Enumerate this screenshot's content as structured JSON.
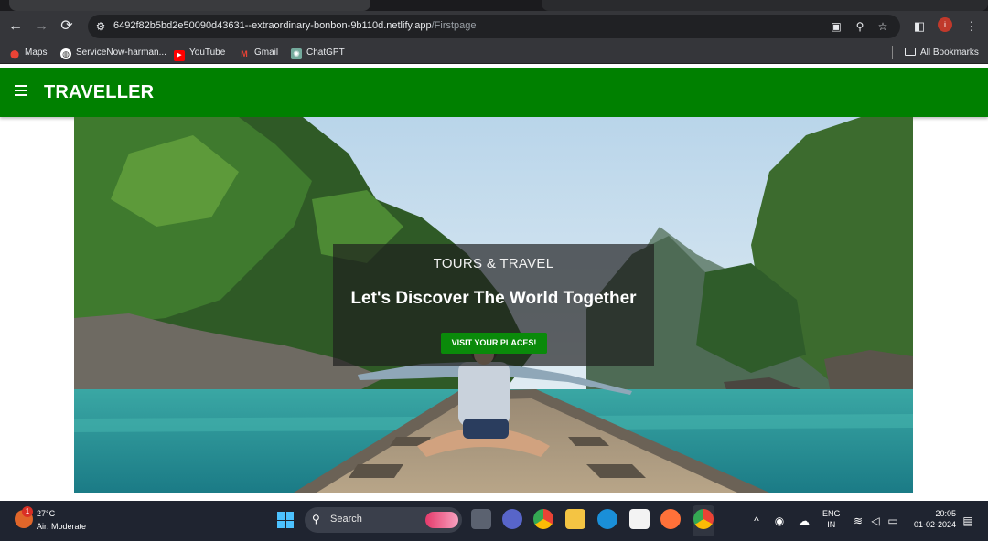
{
  "browser": {
    "url_host": "6492f82b5bd2e50090d43631--extraordinary-bonbon-9b110d.netlify.app",
    "url_path": "/Firstpage",
    "bookmarks": [
      {
        "label": "Maps",
        "icon": "maps-icon"
      },
      {
        "label": "ServiceNow-harman...",
        "icon": "servicenow-icon"
      },
      {
        "label": "YouTube",
        "icon": "youtube-icon"
      },
      {
        "label": "Gmail",
        "icon": "gmail-icon"
      },
      {
        "label": "ChatGPT",
        "icon": "chatgpt-icon"
      }
    ],
    "all_bookmarks_label": "All Bookmarks",
    "profile_initial": "i"
  },
  "site": {
    "brand": "TRAVELLER",
    "header_color": "#008000",
    "hero": {
      "subtitle": "TOURS & TRAVEL",
      "headline": "Let's Discover The World Together",
      "cta_label": "VISIT YOUR PLACES!",
      "cta_color": "#0a8a0a"
    }
  },
  "taskbar": {
    "weather_temp": "27°C",
    "weather_condition": "Air: Moderate",
    "weather_badge": "1",
    "search_label": "Search",
    "lang_primary": "ENG",
    "lang_region": "IN",
    "time": "20:05",
    "date": "01-02-2024"
  }
}
